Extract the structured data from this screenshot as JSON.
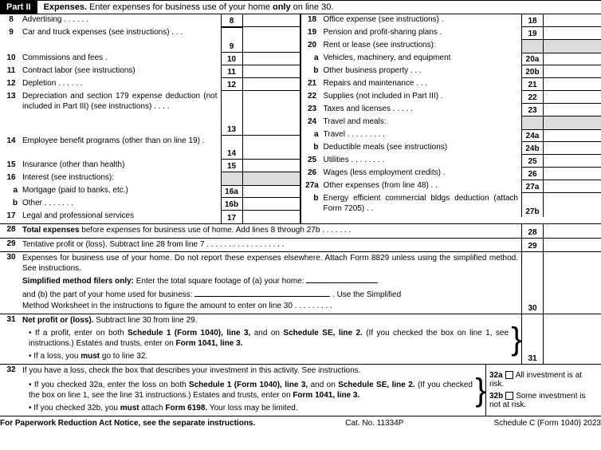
{
  "part": {
    "tag": "Part II",
    "titleStrong": "Expenses.",
    "titleRest": " Enter expenses for business use of your home ",
    "only": "only",
    "titleEnd": " on line 30."
  },
  "left": {
    "l8": {
      "num": "8",
      "desc": "Advertising .    .    .    .    .    .",
      "box": "8"
    },
    "l9": {
      "num": "9",
      "desc": "Car and truck expenses (see instructions)    .    .    .",
      "box": "9"
    },
    "l10": {
      "num": "10",
      "desc": "Commissions and fees    .",
      "box": "10"
    },
    "l11": {
      "num": "11",
      "desc": "Contract labor (see instructions)",
      "box": "11"
    },
    "l12": {
      "num": "12",
      "desc": "Depletion    .    .    .    .    .    .",
      "box": "12"
    },
    "l13": {
      "num": "13",
      "desc": "Depreciation and section 179 expense deduction (not included in Part III) (see instructions)    .    .    .    .",
      "box": "13"
    },
    "l14": {
      "num": "14",
      "desc": "Employee benefit programs (other than on line 19)    .",
      "box": "14"
    },
    "l15": {
      "num": "15",
      "desc": "Insurance (other than health)",
      "box": "15"
    },
    "l16": {
      "num": "16",
      "desc": "Interest (see instructions):"
    },
    "l16a": {
      "num": "a",
      "desc": "Mortgage (paid to banks, etc.)",
      "box": "16a"
    },
    "l16b": {
      "num": "b",
      "desc": "Other    .    .    .    .    .    .    .",
      "box": "16b"
    },
    "l17": {
      "num": "17",
      "desc": "Legal and professional services",
      "box": "17"
    }
  },
  "right": {
    "l18": {
      "num": "18",
      "desc": "Office expense (see instructions)  .",
      "box": "18"
    },
    "l19": {
      "num": "19",
      "desc": "Pension and profit-sharing plans  .",
      "box": "19"
    },
    "l20": {
      "num": "20",
      "desc": "Rent or lease (see instructions):"
    },
    "l20a": {
      "num": "a",
      "desc": "Vehicles, machinery, and equipment",
      "box": "20a"
    },
    "l20b": {
      "num": "b",
      "desc": "Other business property    .    .    .",
      "box": "20b"
    },
    "l21": {
      "num": "21",
      "desc": "Repairs and maintenance    .    .    .",
      "box": "21"
    },
    "l22": {
      "num": "22",
      "desc": "Supplies (not included in Part III)  .",
      "box": "22"
    },
    "l23": {
      "num": "23",
      "desc": "Taxes and licenses .    .    .    .    .",
      "box": "23"
    },
    "l24": {
      "num": "24",
      "desc": "Travel and meals:"
    },
    "l24a": {
      "num": "a",
      "desc": "Travel .    .    .    .    .    .    .    .    .",
      "box": "24a"
    },
    "l24b": {
      "num": "b",
      "desc": "Deductible meals (see instructions)",
      "box": "24b"
    },
    "l25": {
      "num": "25",
      "desc": "Utilities    .    .    .    .    .    .    .    .",
      "box": "25"
    },
    "l26": {
      "num": "26",
      "desc": "Wages (less employment credits)  .",
      "box": "26"
    },
    "l27a": {
      "num": "27a",
      "desc": "Other expenses (from line 48)  .    .",
      "box": "27a"
    },
    "l27b": {
      "num": "b",
      "desc": "Energy efficient commercial bldgs deduction (attach Form 7205) .   .",
      "box": "27b"
    }
  },
  "bottom": {
    "l28": {
      "num": "28",
      "strong": "Total expenses",
      "rest": " before expenses for business use of home. Add lines 8 through 27b    .    .    .    .    .    .    .",
      "box": "28"
    },
    "l29": {
      "num": "29",
      "desc": "Tentative profit or (loss). Subtract line 28 from line 7 .    .    .    .    .    .    .    .    .    .    .    .    .    .    .    .    .    .",
      "box": "29"
    },
    "l30": {
      "num": "30",
      "p1": "Expenses for business use of your home. Do not report these expenses elsewhere. Attach Form 8829 unless using the simplified method. See instructions.",
      "p2a": "Simplified method filers only:",
      "p2b": " Enter the total square footage of (a) your home:",
      "p3a": "and (b) the part of your home used for business:",
      "p3b": ". Use the Simplified",
      "p4": "Method Worksheet in the instructions to figure the amount to enter on line 30    .    .    .    .    .    .    .    .    .",
      "box": "30"
    },
    "l31": {
      "num": "31",
      "strong": "Net profit or (loss).",
      "rest": " Subtract line 30 from line 29.",
      "b1a": "If a profit, enter on both ",
      "b1b": "Schedule 1 (Form 1040), line 3,",
      "b1c": " and on ",
      "b1d": "Schedule SE, line 2.",
      "b1e": " (If you checked the box on line 1, see instructions.) Estates and trusts, enter on ",
      "b1f": "Form 1041, line 3.",
      "b2a": "If a loss, you ",
      "b2b": "must",
      "b2c": "  go to line 32.",
      "box": "31"
    },
    "l32": {
      "num": "32",
      "p1": "If you have a loss, check the box that describes your investment in this activity. See instructions.",
      "b1a": "If you checked 32a, enter the loss on both ",
      "b1b": "Schedule 1 (Form 1040), line 3,",
      "b1c": " and on ",
      "b1d": "Schedule SE, line 2.",
      "b1e": " (If you checked the box on line 1, see the line 31 instructions.) Estates and trusts, enter on ",
      "b1f": "Form 1041, line 3.",
      "b2a": "If you checked 32b, you ",
      "b2b": "must",
      "b2c": " attach ",
      "b2d": "Form 6198.",
      "b2e": " Your loss may be limited.",
      "c32a": {
        "box": "32a",
        "label": "All investment is at risk."
      },
      "c32b": {
        "box": "32b",
        "label": "Some investment is not at risk."
      }
    }
  },
  "footer": {
    "left": "For Paperwork Reduction Act Notice, see the separate instructions.",
    "center": "Cat. No. 11334P",
    "right": "Schedule C (Form 1040) 2023"
  }
}
